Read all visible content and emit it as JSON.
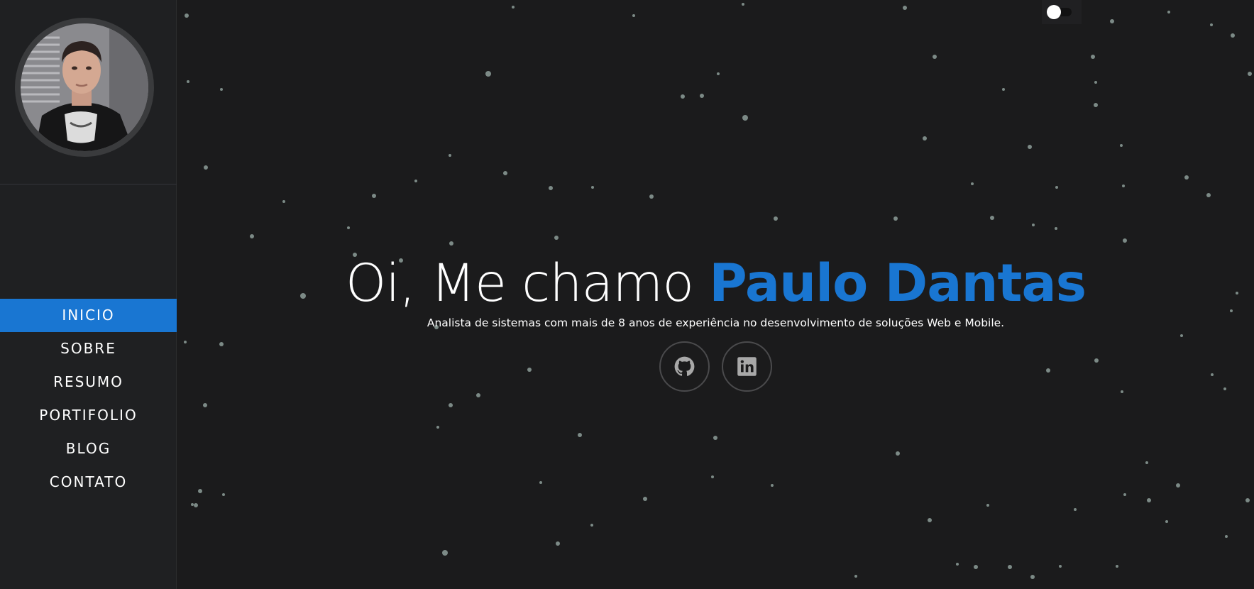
{
  "sidebar": {
    "avatar_alt": "Paulo Dantas",
    "nav": [
      {
        "label": "INICIO",
        "active": true
      },
      {
        "label": "SOBRE",
        "active": false
      },
      {
        "label": "RESUMO",
        "active": false
      },
      {
        "label": "PORTIFOLIO",
        "active": false
      },
      {
        "label": "BLOG",
        "active": false
      },
      {
        "label": "CONTATO",
        "active": false
      }
    ]
  },
  "theme_toggle": {
    "state": "off"
  },
  "hero": {
    "greeting": "Oi, Me chamo",
    "name": "Paulo Dantas",
    "subtitle": "Analista de sistemas com mais de 8 anos de experiência no desenvolvimento de soluções Web e Mobile."
  },
  "socials": [
    {
      "icon": "github-icon"
    },
    {
      "icon": "linkedin-icon"
    }
  ],
  "colors": {
    "background": "#1b1b1c",
    "sidebar": "#1f2022",
    "accent": "#1976d2",
    "particle": "#7c8a86",
    "icon": "#a8a8a8"
  }
}
